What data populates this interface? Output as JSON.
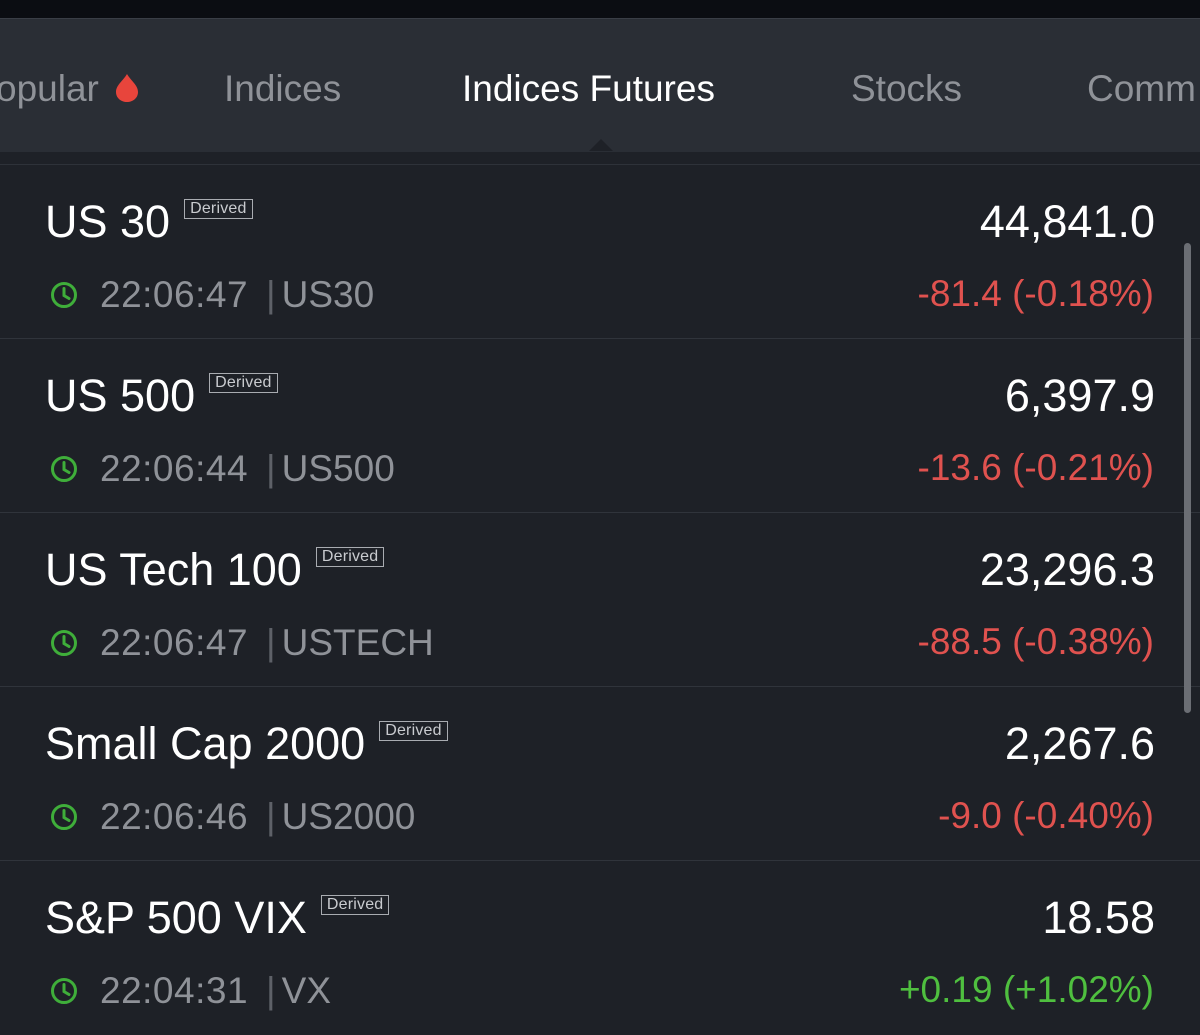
{
  "tabs": [
    {
      "label": "opular",
      "active": false,
      "hot": true
    },
    {
      "label": "Indices",
      "active": false
    },
    {
      "label": "Indices Futures",
      "active": true
    },
    {
      "label": "Stocks",
      "active": false
    },
    {
      "label": "Comm",
      "active": false
    }
  ],
  "colors": {
    "background": "#1e2127",
    "tabbar": "#2a2e35",
    "negative": "#e0524f",
    "positive": "#4fbf3f",
    "clock": "#3fae3a",
    "hot_dot": "#e8453c"
  },
  "icons": {
    "clock": "clock-icon",
    "hot": "hot-drop-icon"
  },
  "rows": [
    {
      "name": "US 30",
      "badge": "Derived",
      "time": "22:06:47",
      "separator": "|",
      "symbol": "US30",
      "price": "44,841.0",
      "change": "-81.4 (-0.18%)",
      "direction": "down"
    },
    {
      "name": "US 500",
      "badge": "Derived",
      "time": "22:06:44",
      "separator": "|",
      "symbol": "US500",
      "price": "6,397.9",
      "change": "-13.6 (-0.21%)",
      "direction": "down"
    },
    {
      "name": "US Tech 100",
      "badge": "Derived",
      "time": "22:06:47",
      "separator": "|",
      "symbol": "USTECH",
      "price": "23,296.3",
      "change": "-88.5 (-0.38%)",
      "direction": "down"
    },
    {
      "name": "Small Cap 2000",
      "badge": "Derived",
      "time": "22:06:46",
      "separator": "|",
      "symbol": "US2000",
      "price": "2,267.6",
      "change": "-9.0 (-0.40%)",
      "direction": "down"
    },
    {
      "name": "S&P 500 VIX",
      "badge": "Derived",
      "time": "22:04:31",
      "separator": "|",
      "symbol": "VX",
      "price": "18.58",
      "change": "+0.19 (+1.02%)",
      "direction": "up"
    }
  ]
}
